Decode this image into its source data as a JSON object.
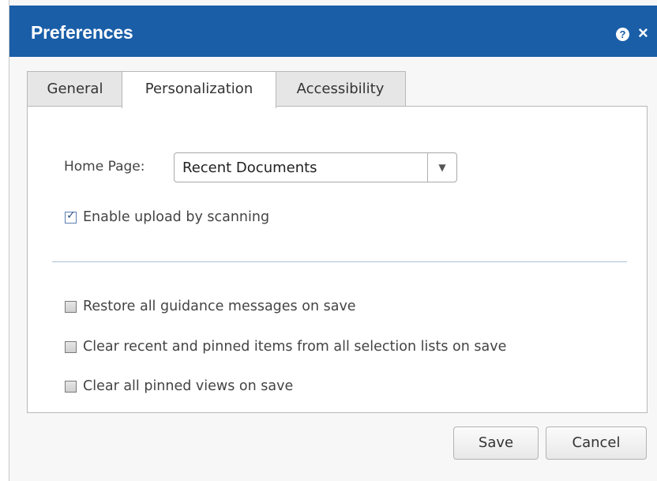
{
  "dialog": {
    "title": "Preferences",
    "help_icon_glyph": "?",
    "close_icon_glyph": "×",
    "title_bar_color": "#1a5ea8"
  },
  "tabs": [
    {
      "label": "General",
      "active": false
    },
    {
      "label": "Personalization",
      "active": true
    },
    {
      "label": "Accessibility",
      "active": false
    }
  ],
  "personalization": {
    "home_page_label": "Home Page:",
    "home_page_value": "Recent Documents",
    "dropdown_icon": "▼",
    "enable_upload": {
      "label": "Enable upload by scanning",
      "checked": true
    },
    "options": [
      {
        "label": "Restore all guidance messages on save",
        "checked": false
      },
      {
        "label": "Clear recent and pinned items from all selection lists on save",
        "checked": false
      },
      {
        "label": "Clear all pinned views on save",
        "checked": false
      }
    ]
  },
  "buttons": {
    "save_label": "Save",
    "cancel_label": "Cancel"
  }
}
